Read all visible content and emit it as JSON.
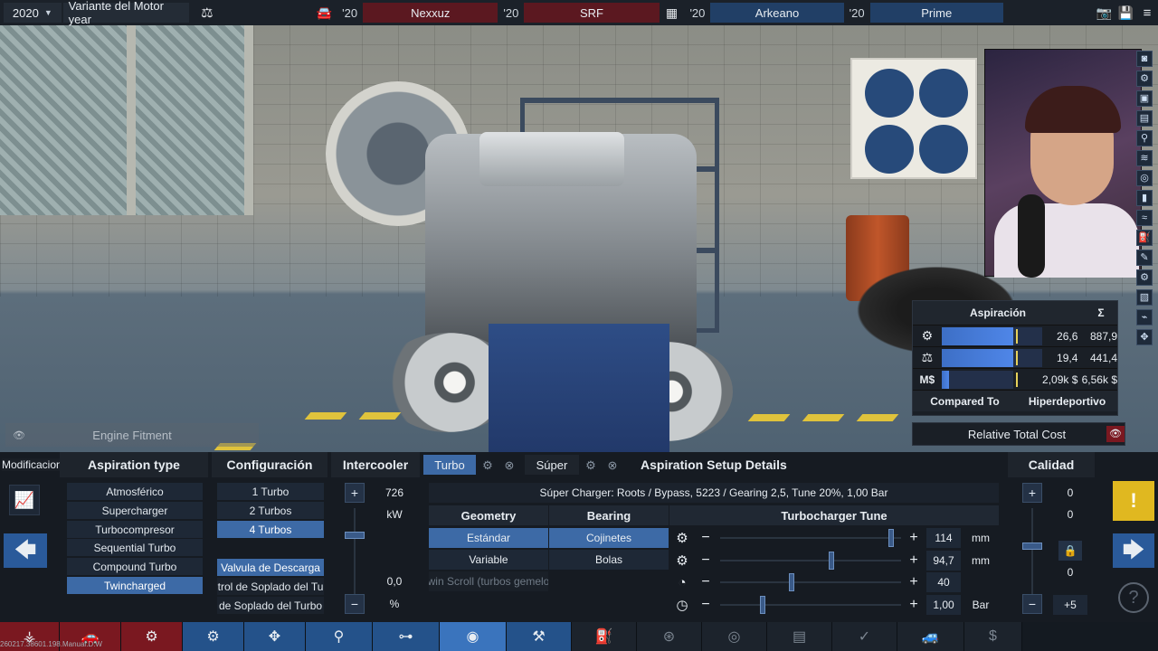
{
  "topbar": {
    "year": "2020",
    "variant": "Variante del Motor year",
    "compare": [
      {
        "year": "'20",
        "name": "Nexxuz",
        "color": "#5b1820"
      },
      {
        "year": "'20",
        "name": "SRF",
        "color": "#5b1820"
      },
      {
        "year": "'20",
        "name": "Arkeano",
        "color": "#213f66"
      },
      {
        "year": "'20",
        "name": "Prime",
        "color": "#213f66"
      }
    ]
  },
  "scene": {
    "engine_fitment": "Engine Fitment"
  },
  "stats": {
    "header": "Aspiración",
    "sum_symbol": "Σ",
    "rows": [
      {
        "icon": "engine-power-icon",
        "value": "26,6",
        "total": "887,9",
        "fill": 0.71
      },
      {
        "icon": "weight-icon",
        "value": "19,4",
        "total": "441,4",
        "fill": 0.71
      },
      {
        "icon": "money-icon",
        "label": "M$",
        "value": "2,09k $",
        "total": "6,56k $",
        "fill": 0.1
      }
    ],
    "compared_to_label": "Compared To",
    "compared_to_value": "Hiperdeportivo",
    "relative_total_cost": "Relative Total Cost"
  },
  "panel": {
    "tooltip_overlap": "Modificacion de las",
    "aspiration_type": {
      "header": "Aspiration type",
      "options": [
        "Atmosférico",
        "Supercharger",
        "Turbocompresor",
        "Sequential Turbo",
        "Compound Turbo",
        "Twincharged"
      ],
      "selected": "Twincharged"
    },
    "configuracion": {
      "header": "Configuración",
      "options": [
        "1 Turbo",
        "2 Turbos",
        "4 Turbos"
      ],
      "selected": "4 Turbos",
      "wastegate": "Valvula de Descarga",
      "boost_control_1": "trol de Soplado del Tu",
      "boost_control_2": "de Soplado del Turbo"
    },
    "intercooler": {
      "header": "Intercooler",
      "value_top": "726",
      "unit_top": "kW",
      "value_bottom": "0,0",
      "unit_bottom": "%"
    },
    "tabs": {
      "turbo": "Turbo",
      "super": "Súper"
    },
    "setup": {
      "header": "Aspiration Setup Details",
      "summary": "Súper Charger: Roots / Bypass, 5223 / Gearing 2,5, Tune 20%, 1,00 Bar",
      "geometry_header": "Geometry",
      "geometry_options": [
        "Estándar",
        "Variable",
        "win Scroll (turbos gemelo"
      ],
      "bearing_header": "Bearing",
      "bearing_options": [
        "Cojinetes",
        "Bolas"
      ],
      "tune_header": "Turbocharger Tune",
      "tune_rows": [
        {
          "icon": "compressor-size-icon",
          "value": "114",
          "unit": "mm",
          "pos": 0.93
        },
        {
          "icon": "turbine-size-icon",
          "value": "94,7",
          "unit": "mm",
          "pos": 0.6
        },
        {
          "icon": "ar-ratio-icon",
          "value": "40",
          "unit": "",
          "pos": 0.38
        },
        {
          "icon": "boost-gauge-icon",
          "value": "1,00",
          "unit": "Bar",
          "pos": 0.22
        }
      ]
    },
    "calidad": {
      "header": "Calidad",
      "values": [
        "0",
        "0",
        "0"
      ],
      "bonus": "+5"
    }
  },
  "version": "260217.38601.198.Manual.D.W"
}
